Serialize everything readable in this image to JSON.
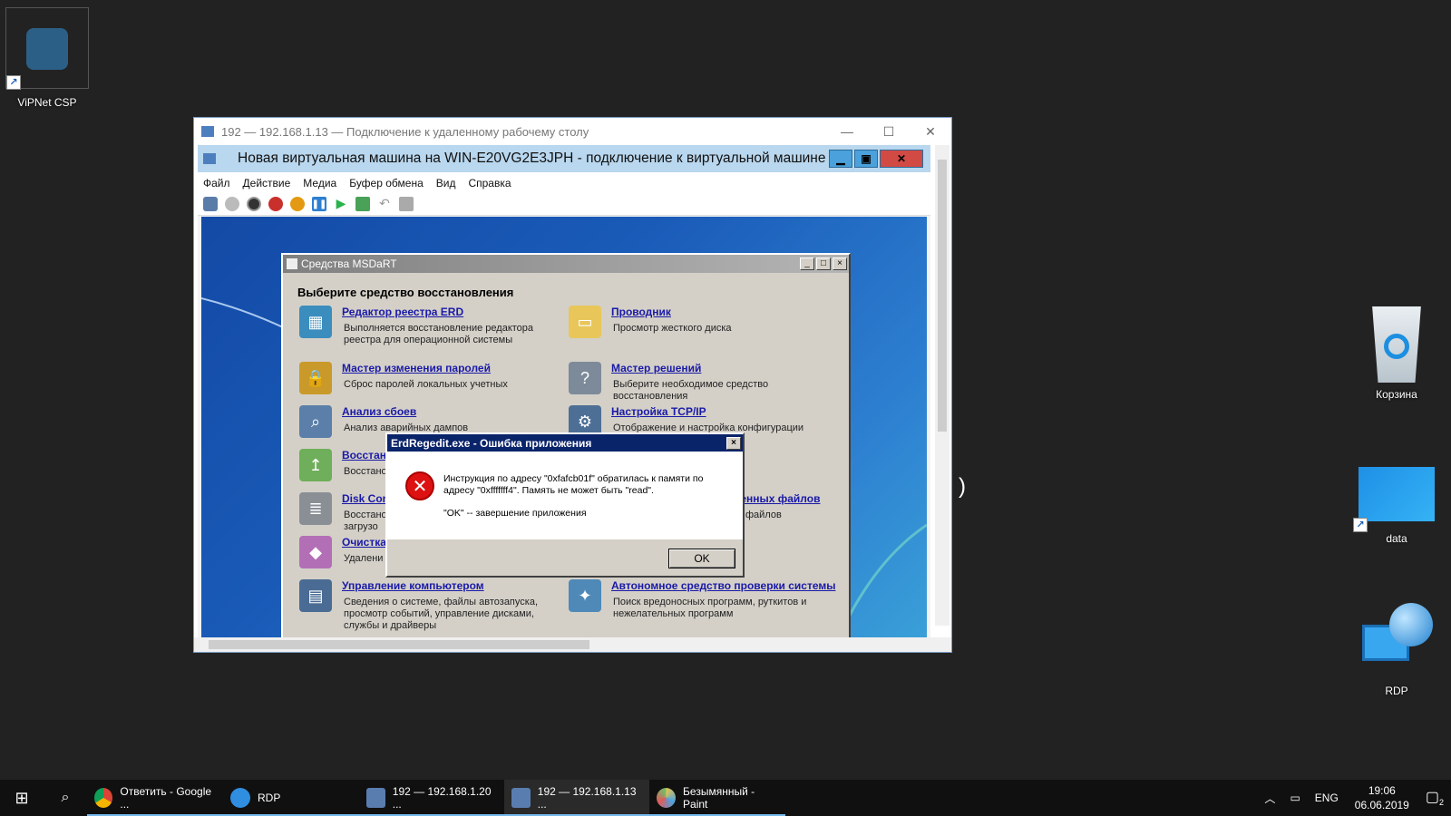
{
  "desktop": {
    "icons": [
      {
        "label": "ViPNet CSP"
      },
      {
        "label": "Корзина"
      },
      {
        "label": "data"
      },
      {
        "label": "RDP"
      }
    ]
  },
  "rdp_window": {
    "title": "192 — 192.168.1.13 — Подключение к удаленному рабочему столу"
  },
  "vm_window": {
    "title": "Новая виртуальная машина на WIN-E20VG2E3JPH - подключение к виртуальной машине",
    "menu": [
      "Файл",
      "Действие",
      "Медиа",
      "Буфер обмена",
      "Вид",
      "Справка"
    ]
  },
  "msdart": {
    "title": "Средства MSDaRT",
    "heading": "Выберите средство восстановления",
    "tools": [
      {
        "name": "Редактор реестра ERD",
        "desc": "Выполняется восстановление редактора реестра для операционной системы"
      },
      {
        "name": "Проводник",
        "desc": "Просмотр жесткого диска"
      },
      {
        "name": "Мастер изменения паролей",
        "desc": "Сброс паролей локальных учетных"
      },
      {
        "name": "Мастер решений",
        "desc": "Выберите необходимое средство восстановления"
      },
      {
        "name": "Анализ сбоев",
        "desc": "Анализ аварийных дампов"
      },
      {
        "name": "Настройка TCP/IP",
        "desc": "Отображение и настройка конфигурации"
      },
      {
        "name": "Восстан",
        "desc": "Восстано"
      },
      {
        "name": "Disk Con",
        "desc": "Восстано загрузо"
      },
      {
        "name": "ренных файлов",
        "desc": "файлов"
      },
      {
        "name": "Очистка",
        "desc": "Удалени"
      },
      {
        "name": "Управление компьютером",
        "desc": "Сведения о системе, файлы автозапуска, просмотр событий, управление дисками, службы и драйверы"
      },
      {
        "name": "Автономное средство проверки системы",
        "desc": "Поиск вредоносных программ, руткитов и нежелательных программ"
      }
    ]
  },
  "error_dialog": {
    "title": "ErdRegedit.exe - Ошибка приложения",
    "message": "Инструкция по адресу \"0xfafcb01f\" обратилась к памяти по адресу \"0xfffffff4\". Память не может быть \"read\".",
    "ok_hint": "\"OK\" -- завершение приложения",
    "ok_button": "OK"
  },
  "taskbar": {
    "tasks": [
      {
        "label": "Ответить - Google ..."
      },
      {
        "label": "RDP"
      },
      {
        "label": "192 — 192.168.1.20 ..."
      },
      {
        "label": "192 — 192.168.1.13 ..."
      },
      {
        "label": "Безымянный - Paint"
      }
    ],
    "lang": "ENG",
    "time": "19:06",
    "date": "06.06.2019",
    "notifications": "2"
  }
}
